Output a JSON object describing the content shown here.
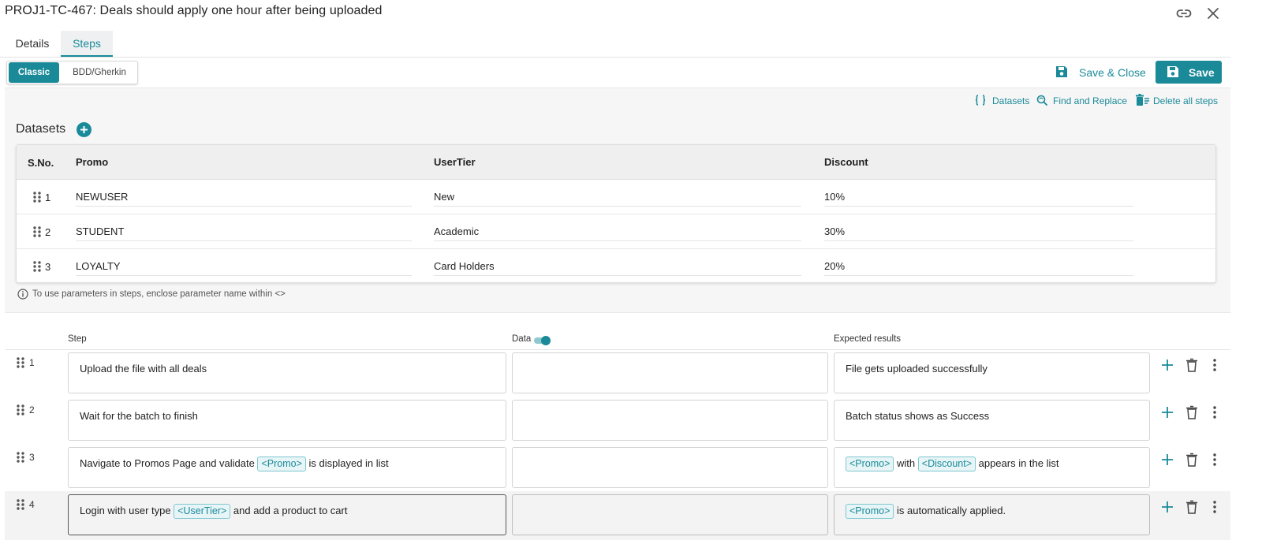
{
  "header": {
    "title": "PROJ1-TC-467: Deals should apply one hour after being uploaded"
  },
  "tabs": [
    {
      "label": "Details"
    },
    {
      "label": "Steps"
    }
  ],
  "mode": {
    "classic": "Classic",
    "bdd": "BDD/Gherkin"
  },
  "actions": {
    "save_close": "Save & Close",
    "save": "Save"
  },
  "tools": {
    "datasets": "Datasets",
    "find_replace": "Find and Replace",
    "delete_all": "Delete all steps"
  },
  "datasets": {
    "title": "Datasets",
    "columns": [
      "S.No.",
      "Promo",
      "UserTier",
      "Discount"
    ],
    "rows": [
      {
        "num": "1",
        "promo": "NEWUSER",
        "tier": "New",
        "discount": "10%"
      },
      {
        "num": "2",
        "promo": "STUDENT",
        "tier": "Academic",
        "discount": "30%"
      },
      {
        "num": "3",
        "promo": "LOYALTY",
        "tier": "Card Holders",
        "discount": "20%"
      }
    ],
    "hint": "To use parameters in steps, enclose parameter name within <>"
  },
  "steps": {
    "col_step": "Step",
    "col_data": "Data",
    "col_expected": "Expected results",
    "rows": [
      {
        "num": "1",
        "step": [
          "Upload the file with all deals"
        ],
        "data": "",
        "expected": [
          "File gets uploaded successfully"
        ]
      },
      {
        "num": "2",
        "step": [
          "Wait for the batch to finish"
        ],
        "data": "",
        "expected": [
          "Batch status shows as Success"
        ]
      },
      {
        "num": "3",
        "step": [
          "Navigate to Promos Page and validate ",
          "<Promo>",
          " is displayed in list"
        ],
        "data": "",
        "expected": [
          "",
          "<Promo>",
          " with ",
          "<Discount>",
          " appears in the list"
        ]
      },
      {
        "num": "4",
        "step": [
          "Login with user type ",
          "<UserTier>",
          " and add a product to cart"
        ],
        "data": "",
        "expected": [
          "",
          "<Promo>",
          " is automatically applied."
        ]
      }
    ]
  },
  "colors": {
    "accent": "#1a8a99",
    "chip_bg": "#e7f5f7",
    "panel_bg": "#f6f6f6"
  }
}
